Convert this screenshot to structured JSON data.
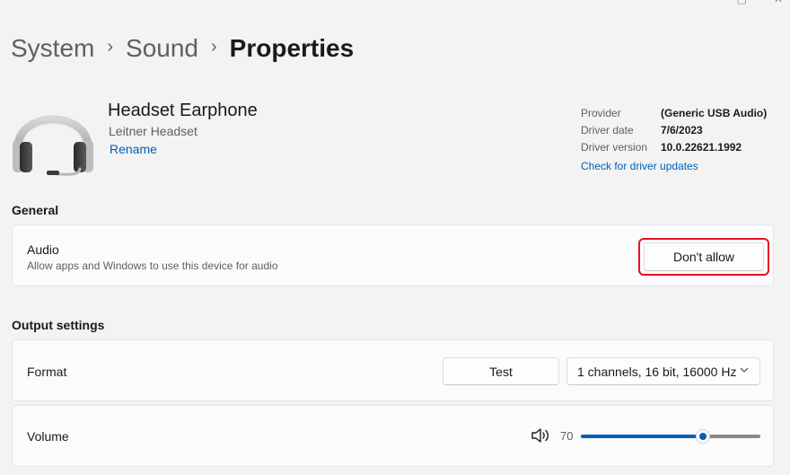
{
  "window": {
    "icons": [
      "restore-icon",
      "close-icon"
    ]
  },
  "breadcrumb": {
    "items": [
      "System",
      "Sound",
      "Properties"
    ],
    "separator": "›"
  },
  "device": {
    "name": "Headset Earphone",
    "subtitle": "Leitner Headset",
    "rename_label": "Rename",
    "icon": "headset-icon"
  },
  "driver": {
    "provider_label": "Provider",
    "provider_value": "(Generic USB Audio)",
    "date_label": "Driver date",
    "date_value": "7/6/2023",
    "version_label": "Driver version",
    "version_value": "10.0.22621.1992",
    "update_link": "Check for driver updates"
  },
  "general": {
    "heading": "General",
    "audio": {
      "title": "Audio",
      "description": "Allow apps and Windows to use this device for audio",
      "button_label": "Don't allow",
      "highlight_color": "#e81123"
    }
  },
  "output": {
    "heading": "Output settings",
    "format": {
      "label": "Format",
      "test_button": "Test",
      "selected": "1 channels, 16 bit, 16000 Hz",
      "dropdown_icon": "chevron-down-icon"
    },
    "volume": {
      "label": "Volume",
      "icon": "speaker-icon",
      "value": "70",
      "level_fraction": 0.68
    }
  },
  "colors": {
    "accent": "#005fb8",
    "background": "#f3f3f3",
    "card": "#fbfbfb"
  }
}
